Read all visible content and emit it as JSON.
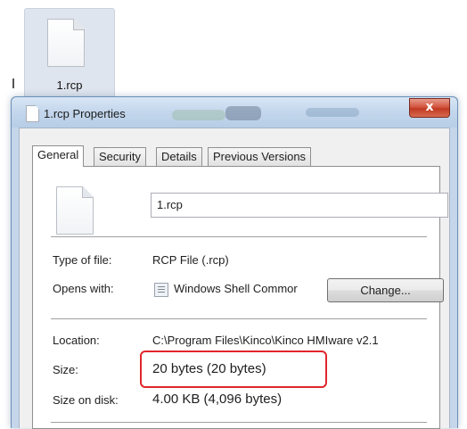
{
  "desktop": {
    "file_label": "1.rcp"
  },
  "window": {
    "title": "1.rcp Properties",
    "close_glyph": "x",
    "tabs": [
      {
        "label": "General",
        "active": true
      },
      {
        "label": "Security",
        "active": false
      },
      {
        "label": "Details",
        "active": false
      },
      {
        "label": "Previous Versions",
        "active": false
      }
    ]
  },
  "general": {
    "file_name": "1.rcp",
    "type_label": "Type of file:",
    "type_value": "RCP File (.rcp)",
    "opens_label": "Opens with:",
    "opens_value": "Windows Shell Commor",
    "change_button": "Change...",
    "location_label": "Location:",
    "location_value": "C:\\Program Files\\Kinco\\Kinco HMIware v2.1",
    "size_label": "Size:",
    "size_value": "20 bytes (20 bytes)",
    "size_on_disk_label": "Size on disk:",
    "size_on_disk_value": "4.00 KB (4,096 bytes)"
  },
  "icons": {
    "file": "document-icon",
    "app": "application-icon",
    "close": "close-icon"
  },
  "colors": {
    "highlight": "#e0262a",
    "close_button": "#c23a22",
    "window_frame": "#c5d6ea"
  }
}
